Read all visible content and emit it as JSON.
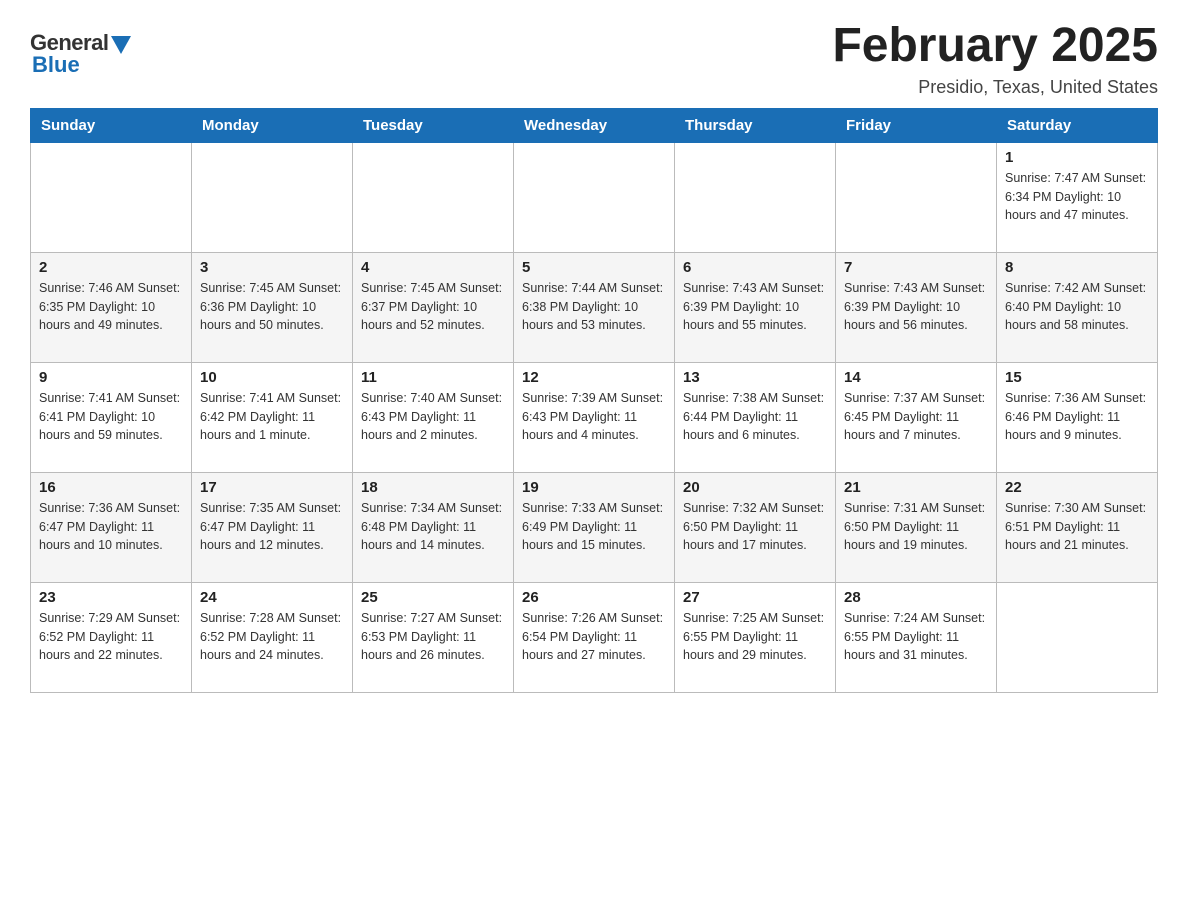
{
  "header": {
    "logo_general": "General",
    "logo_blue": "Blue",
    "month_title": "February 2025",
    "location": "Presidio, Texas, United States"
  },
  "weekdays": [
    "Sunday",
    "Monday",
    "Tuesday",
    "Wednesday",
    "Thursday",
    "Friday",
    "Saturday"
  ],
  "weeks": [
    {
      "days": [
        {
          "num": "",
          "info": ""
        },
        {
          "num": "",
          "info": ""
        },
        {
          "num": "",
          "info": ""
        },
        {
          "num": "",
          "info": ""
        },
        {
          "num": "",
          "info": ""
        },
        {
          "num": "",
          "info": ""
        },
        {
          "num": "1",
          "info": "Sunrise: 7:47 AM\nSunset: 6:34 PM\nDaylight: 10 hours and 47 minutes."
        }
      ]
    },
    {
      "days": [
        {
          "num": "2",
          "info": "Sunrise: 7:46 AM\nSunset: 6:35 PM\nDaylight: 10 hours and 49 minutes."
        },
        {
          "num": "3",
          "info": "Sunrise: 7:45 AM\nSunset: 6:36 PM\nDaylight: 10 hours and 50 minutes."
        },
        {
          "num": "4",
          "info": "Sunrise: 7:45 AM\nSunset: 6:37 PM\nDaylight: 10 hours and 52 minutes."
        },
        {
          "num": "5",
          "info": "Sunrise: 7:44 AM\nSunset: 6:38 PM\nDaylight: 10 hours and 53 minutes."
        },
        {
          "num": "6",
          "info": "Sunrise: 7:43 AM\nSunset: 6:39 PM\nDaylight: 10 hours and 55 minutes."
        },
        {
          "num": "7",
          "info": "Sunrise: 7:43 AM\nSunset: 6:39 PM\nDaylight: 10 hours and 56 minutes."
        },
        {
          "num": "8",
          "info": "Sunrise: 7:42 AM\nSunset: 6:40 PM\nDaylight: 10 hours and 58 minutes."
        }
      ]
    },
    {
      "days": [
        {
          "num": "9",
          "info": "Sunrise: 7:41 AM\nSunset: 6:41 PM\nDaylight: 10 hours and 59 minutes."
        },
        {
          "num": "10",
          "info": "Sunrise: 7:41 AM\nSunset: 6:42 PM\nDaylight: 11 hours and 1 minute."
        },
        {
          "num": "11",
          "info": "Sunrise: 7:40 AM\nSunset: 6:43 PM\nDaylight: 11 hours and 2 minutes."
        },
        {
          "num": "12",
          "info": "Sunrise: 7:39 AM\nSunset: 6:43 PM\nDaylight: 11 hours and 4 minutes."
        },
        {
          "num": "13",
          "info": "Sunrise: 7:38 AM\nSunset: 6:44 PM\nDaylight: 11 hours and 6 minutes."
        },
        {
          "num": "14",
          "info": "Sunrise: 7:37 AM\nSunset: 6:45 PM\nDaylight: 11 hours and 7 minutes."
        },
        {
          "num": "15",
          "info": "Sunrise: 7:36 AM\nSunset: 6:46 PM\nDaylight: 11 hours and 9 minutes."
        }
      ]
    },
    {
      "days": [
        {
          "num": "16",
          "info": "Sunrise: 7:36 AM\nSunset: 6:47 PM\nDaylight: 11 hours and 10 minutes."
        },
        {
          "num": "17",
          "info": "Sunrise: 7:35 AM\nSunset: 6:47 PM\nDaylight: 11 hours and 12 minutes."
        },
        {
          "num": "18",
          "info": "Sunrise: 7:34 AM\nSunset: 6:48 PM\nDaylight: 11 hours and 14 minutes."
        },
        {
          "num": "19",
          "info": "Sunrise: 7:33 AM\nSunset: 6:49 PM\nDaylight: 11 hours and 15 minutes."
        },
        {
          "num": "20",
          "info": "Sunrise: 7:32 AM\nSunset: 6:50 PM\nDaylight: 11 hours and 17 minutes."
        },
        {
          "num": "21",
          "info": "Sunrise: 7:31 AM\nSunset: 6:50 PM\nDaylight: 11 hours and 19 minutes."
        },
        {
          "num": "22",
          "info": "Sunrise: 7:30 AM\nSunset: 6:51 PM\nDaylight: 11 hours and 21 minutes."
        }
      ]
    },
    {
      "days": [
        {
          "num": "23",
          "info": "Sunrise: 7:29 AM\nSunset: 6:52 PM\nDaylight: 11 hours and 22 minutes."
        },
        {
          "num": "24",
          "info": "Sunrise: 7:28 AM\nSunset: 6:52 PM\nDaylight: 11 hours and 24 minutes."
        },
        {
          "num": "25",
          "info": "Sunrise: 7:27 AM\nSunset: 6:53 PM\nDaylight: 11 hours and 26 minutes."
        },
        {
          "num": "26",
          "info": "Sunrise: 7:26 AM\nSunset: 6:54 PM\nDaylight: 11 hours and 27 minutes."
        },
        {
          "num": "27",
          "info": "Sunrise: 7:25 AM\nSunset: 6:55 PM\nDaylight: 11 hours and 29 minutes."
        },
        {
          "num": "28",
          "info": "Sunrise: 7:24 AM\nSunset: 6:55 PM\nDaylight: 11 hours and 31 minutes."
        },
        {
          "num": "",
          "info": ""
        }
      ]
    }
  ]
}
